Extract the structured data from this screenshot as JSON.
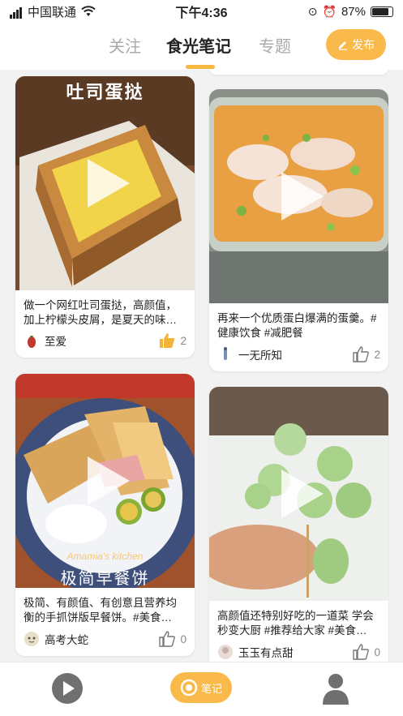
{
  "status_bar": {
    "carrier": "中国联通",
    "time": "下午4:36",
    "battery": "87%"
  },
  "tabs": [
    {
      "label": "关注",
      "active": false
    },
    {
      "label": "食光笔记",
      "active": true
    },
    {
      "label": "专题",
      "active": false
    }
  ],
  "publish_label": "发布",
  "feed": [
    {
      "media_text": "吐司蛋挞",
      "caption": "做一个网红吐司蛋挞，高颜值，加上柠檬头皮屑，是夏天的味…",
      "author": "至爱",
      "likes": "2",
      "liked": true
    },
    {
      "media_text": "",
      "caption": "再来一个优质蛋白爆满的蛋羹。#健康饮食 #减肥餐",
      "author": "一无所知",
      "likes": "2",
      "liked": false
    },
    {
      "media_text": "Amamia's kitchen",
      "media_text2": "极简早餐饼",
      "caption": "极简、有颜值、有创意且营养均衡的手抓饼版早餐饼。#美食…",
      "author": "高考大蛇",
      "likes": "0",
      "liked": false
    },
    {
      "media_text": "",
      "caption": "高颜值还特别好吃的一道菜 学会秒变大厨 #推荐给大家 #美食…",
      "author": "玉玉有点甜",
      "likes": "0",
      "liked": false
    }
  ],
  "bottom_nav": {
    "notes_label": "笔记"
  },
  "colors": {
    "accent": "#f9b94b",
    "like_active": "#f0b43a"
  },
  "icons": [
    "signal-bars-icon",
    "wifi-icon",
    "lock-rotation-icon",
    "alarm-icon",
    "battery-icon",
    "pencil-icon",
    "play-icon",
    "thumb-up-icon",
    "video-play-icon",
    "notes-icon",
    "user-icon"
  ]
}
